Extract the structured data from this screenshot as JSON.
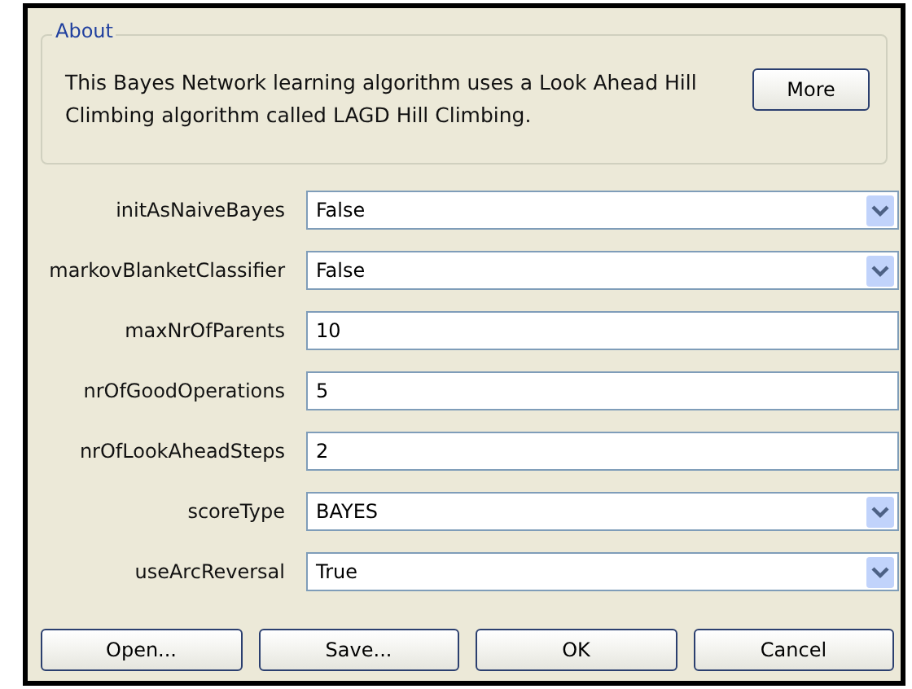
{
  "about": {
    "title": "About",
    "text": "This Bayes Network learning algorithm uses a Look Ahead Hill Climbing algorithm called LAGD Hill Climbing.",
    "button": "More"
  },
  "properties": [
    {
      "label": "initAsNaiveBayes",
      "kind": "dropdown",
      "value": "False"
    },
    {
      "label": "markovBlanketClassifier",
      "kind": "dropdown",
      "value": "False"
    },
    {
      "label": "maxNrOfParents",
      "kind": "text",
      "value": "10"
    },
    {
      "label": "nrOfGoodOperations",
      "kind": "text",
      "value": "5"
    },
    {
      "label": "nrOfLookAheadSteps",
      "kind": "text",
      "value": "2"
    },
    {
      "label": "scoreType",
      "kind": "dropdown",
      "value": "BAYES"
    },
    {
      "label": "useArcReversal",
      "kind": "dropdown",
      "value": "True"
    }
  ],
  "buttons": [
    "Open...",
    "Save...",
    "OK",
    "Cancel"
  ]
}
